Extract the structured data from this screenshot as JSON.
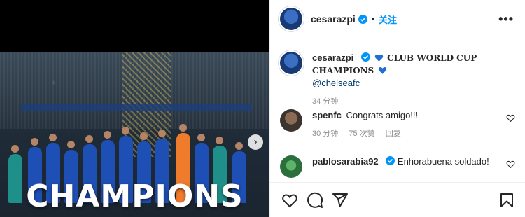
{
  "post": {
    "image_overlay_text": "CHAMPIONS",
    "carousel_next_icon": "chevron-right-icon"
  },
  "header": {
    "username": "cesarazpi",
    "verified_icon": "verified-badge-icon",
    "separator": "•",
    "follow_label": "关注",
    "more_icon": "more-icon",
    "more_label": "•••"
  },
  "caption": {
    "username": "cesarazpi",
    "text": "CLUB WORLD CUP CHAMPIONS",
    "mention": "@chelseafc",
    "time": "34 分钟",
    "emoji": "blue-heart-icon"
  },
  "comments": [
    {
      "username": "spenfc",
      "text": "Congrats amigo!!!",
      "time": "30 分钟",
      "likes": "75 次赞",
      "reply_label": "回复"
    },
    {
      "username": "pablosarabia92",
      "verified": true,
      "text": "Enhorabuena soldado!"
    }
  ],
  "actions": {
    "like_icon": "heart-icon",
    "comment_icon": "comment-icon",
    "share_icon": "share-icon",
    "save_icon": "bookmark-icon"
  },
  "colors": {
    "accent": "#0095f6",
    "verified": "#0095f6",
    "heart_emoji": "#1d6fd6",
    "muted_text": "#8e8e8e",
    "mention": "#00376b"
  }
}
